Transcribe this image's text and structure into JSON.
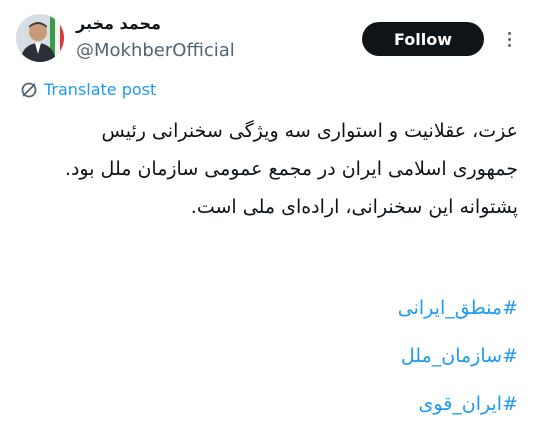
{
  "header": {
    "display_name": "محمد مخبر",
    "handle": "@MokhberOfficial",
    "follow_label": "Follow"
  },
  "translate_label": "Translate post",
  "tweet": {
    "lines": [
      "عزت، عقلانیت و استواری سه ویژگی سخنرانی رئیس",
      "جمهوری اسلامی ایران در مجمع عمومی سازمان ملل بود.",
      "پشتوانه این سخنرانی، اراده‌ای ملی است."
    ]
  },
  "hashtags": [
    "#منطق_ایرانی",
    "#سازمان_ملل",
    "#ایران_قوی"
  ],
  "colors": {
    "link": "#1d9bf0",
    "text": "#0f1419",
    "secondary": "#536471",
    "follow_bg": "#0f1419"
  },
  "icons": {
    "translate": "globe-slash-icon",
    "more": "more-dots-icon"
  }
}
